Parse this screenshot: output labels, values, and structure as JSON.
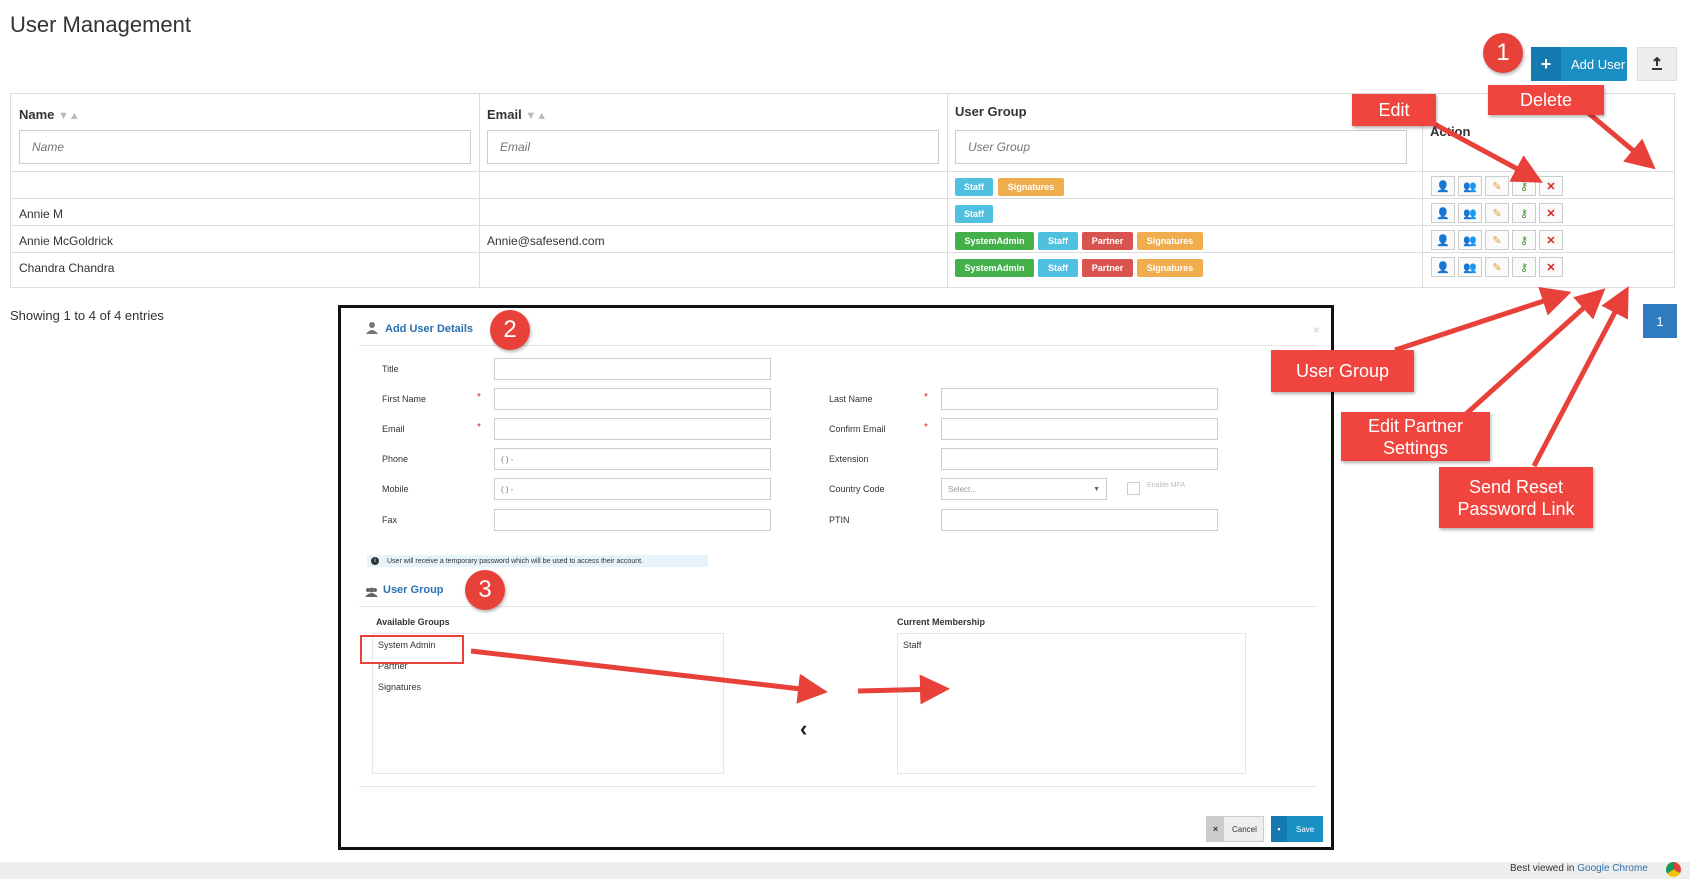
{
  "page": {
    "title": "User Management"
  },
  "toolbar": {
    "add_user_label": "Add User",
    "add_user_icon": "plus-icon",
    "export_icon": "export-icon"
  },
  "table": {
    "columns": [
      {
        "label": "Name",
        "filter_placeholder": "Name"
      },
      {
        "label": "Email",
        "filter_placeholder": "Email"
      },
      {
        "label": "User Group",
        "filter_placeholder": "User Group"
      },
      {
        "label": "Action"
      }
    ],
    "rows": [
      {
        "name": "",
        "email": "",
        "groups": [
          "Staff",
          "Signatures"
        ]
      },
      {
        "name": "Annie M",
        "email": "",
        "groups": [
          "Staff"
        ]
      },
      {
        "name": "Annie McGoldrick",
        "email": "Annie@safesend.com",
        "groups": [
          "SystemAdmin",
          "Staff",
          "Partner",
          "Signatures"
        ]
      },
      {
        "name": "Chandra Chandra",
        "email": "",
        "groups": [
          "SystemAdmin",
          "Staff",
          "Partner",
          "Signatures"
        ]
      }
    ],
    "group_colors": {
      "Staff": "#4fc0e0",
      "Signatures": "#f0ad4e",
      "SystemAdmin": "#43b049",
      "Partner": "#d9534f"
    },
    "action_icons": [
      "edit-user-icon",
      "user-group-icon",
      "edit-partner-settings-icon",
      "key-icon",
      "delete-icon"
    ]
  },
  "pagination": {
    "showing_text": "Showing 1 to 4 of 4 entries",
    "current_page": "1"
  },
  "modal": {
    "title": "Add User Details",
    "fields": {
      "title": "Title",
      "first_name": "First Name",
      "last_name": "Last Name",
      "email": "Email",
      "confirm_email": "Confirm Email",
      "phone": "Phone",
      "phone_placeholder": "( ) -",
      "extension": "Extension",
      "mobile": "Mobile",
      "mobile_placeholder": "( ) -",
      "country_code": "Country Code",
      "country_code_value": "Select...",
      "enable_mfa": "Enable MFA",
      "fax": "Fax",
      "ptin": "PTIN",
      "required_mark": "*"
    },
    "info_text": "User will receive a temporary password which will be used to access their account.",
    "user_group_title": "User Group",
    "available_groups_title": "Available Groups",
    "available_groups": [
      "System Admin",
      "Partner",
      "Signatures"
    ],
    "current_membership_title": "Current Membership",
    "current_membership": [
      "Staff"
    ],
    "cancel_label": "Cancel",
    "save_label": "Save"
  },
  "annotations": {
    "badges": [
      "1",
      "2",
      "3"
    ],
    "edit": "Edit",
    "delete": "Delete",
    "user_group": "User Group",
    "edit_partner_settings": "Edit Partner Settings",
    "send_reset_password_link": "Send Reset Password Link",
    "accent_color": "#e8413a"
  },
  "footer": {
    "best_viewed_prefix": "Best viewed in",
    "browser": "Google Chrome"
  }
}
